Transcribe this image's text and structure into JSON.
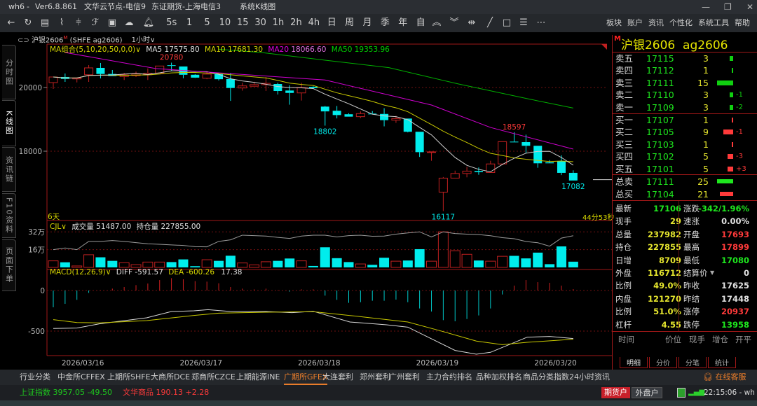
{
  "titlebar": {
    "app": "wh6",
    "sep": "-",
    "version": "Ver6.8.861",
    "node": "文华云节点-电信9",
    "broker": "东证期货-上海电信3",
    "window": "系统K线图"
  },
  "toolbar": {
    "periods": [
      "5s",
      "1",
      "5",
      "10",
      "15",
      "30",
      "1h",
      "2h",
      "4h",
      "日",
      "周",
      "月",
      "季",
      "年",
      "自"
    ],
    "menu": [
      "板块",
      "账户",
      "资讯",
      "个性化",
      "系统工具",
      "帮助"
    ]
  },
  "subheader": {
    "contract": "沪银2606",
    "marker": "M",
    "code": "(SHFE ag2606)",
    "period": "1小时"
  },
  "side_tabs": [
    "分时图",
    "K线图",
    "资讯链",
    "F10资料",
    "页面下单"
  ],
  "legend": {
    "ma_label": "MA组合(5,10,20,50,0,0)",
    "ma5": "MA5 17575.80",
    "ma10": "MA10 17681.30",
    "ma20": "MA20",
    "ma20_val": "18066.60",
    "ma50": "MA50 19353.96",
    "cjl": "CJL",
    "vol": "成交量 51487.00",
    "oi": "持仓量 227855.00",
    "macd": "MACD(12,26,9)",
    "diff": "DIFF -591.57",
    "dea": "DEA -600.26",
    "macd_val": "17.38",
    "days": "6天",
    "countdown": "44分53秒"
  },
  "chart_data": {
    "type": "candlestick",
    "price_ticks": [
      20000,
      18000
    ],
    "volume_ticks": [
      "32万",
      "16万"
    ],
    "volume_tick_values": [
      320000,
      160000
    ],
    "macd_ticks": [
      "0",
      "-500"
    ],
    "macd_tick_values": [
      0,
      -500
    ],
    "x_date_labels": [
      "2026/03/16",
      "2026/03/17",
      "2026/03/18",
      "2026/03/19",
      "2026/03/20"
    ],
    "x_date_positions": [
      2.5,
      12.5,
      22.5,
      32.5,
      42.5
    ],
    "annotations": [
      {
        "text": "20780",
        "index": 10,
        "color": "#ff3a3a",
        "pos": "above"
      },
      {
        "text": "18802",
        "index": 23,
        "color": "#00e8e8",
        "pos": "below"
      },
      {
        "text": "18597",
        "index": 39,
        "color": "#ff3a3a",
        "pos": "above"
      },
      {
        "text": "16117",
        "index": 33,
        "color": "#00e8e8",
        "pos": "below"
      },
      {
        "text": "17082",
        "index": 44,
        "color": "#00e8e8",
        "pos": "below"
      }
    ],
    "ohlc": [
      [
        20154,
        20330,
        19956,
        20330
      ],
      [
        20330,
        20440,
        20176,
        20270
      ],
      [
        20270,
        20310,
        20160,
        20300
      ],
      [
        20400,
        20704,
        20176,
        20616
      ],
      [
        20616,
        20770,
        20286,
        20425
      ],
      [
        20425,
        20550,
        20360,
        20360
      ],
      [
        20345,
        20460,
        20236,
        20396
      ],
      [
        20374,
        20500,
        20330,
        20425
      ],
      [
        20400,
        20600,
        20236,
        20447
      ],
      [
        20455,
        20675,
        20455,
        20675
      ],
      [
        20700,
        20780,
        20530,
        20680
      ],
      [
        20660,
        20660,
        20290,
        20400
      ],
      [
        20400,
        20420,
        20300,
        20310
      ],
      [
        20290,
        20500,
        20260,
        20420
      ],
      [
        20420,
        20420,
        20220,
        20260
      ],
      [
        20264,
        20460,
        19580,
        19985
      ],
      [
        19985,
        20150,
        19900,
        20050
      ],
      [
        20040,
        20180,
        20040,
        20090
      ],
      [
        20090,
        20330,
        19890,
        20130
      ],
      [
        20110,
        20150,
        19780,
        19890
      ],
      [
        19905,
        20070,
        19460,
        19830
      ],
      [
        19830,
        20150,
        19590,
        20000
      ],
      [
        20020,
        20040,
        19970,
        19980
      ],
      [
        19400,
        19420,
        18802,
        19250
      ],
      [
        19270,
        19420,
        19030,
        19135
      ],
      [
        19160,
        19190,
        19085,
        19085
      ],
      [
        19085,
        19250,
        19040,
        19180
      ],
      [
        19180,
        19260,
        19160,
        19160
      ],
      [
        19170,
        19350,
        18780,
        18975
      ],
      [
        18975,
        19110,
        18890,
        19025
      ],
      [
        19025,
        19025,
        18590,
        18610
      ],
      [
        18610,
        18610,
        17820,
        17970
      ],
      [
        17970,
        17990,
        17700,
        17980
      ],
      [
        16715,
        17190,
        16117,
        17155
      ],
      [
        17155,
        17390,
        17155,
        17300
      ],
      [
        17300,
        17510,
        17180,
        17375
      ],
      [
        17375,
        17490,
        17260,
        17340
      ],
      [
        17330,
        17700,
        17330,
        17600
      ],
      [
        17600,
        18300,
        17560,
        18300
      ],
      [
        18300,
        18597,
        18280,
        18280
      ],
      [
        18285,
        18520,
        17950,
        18170
      ],
      [
        18170,
        18170,
        17480,
        17620
      ],
      [
        17650,
        17720,
        17620,
        17620
      ],
      [
        17690,
        17870,
        17250,
        17320
      ],
      [
        17320,
        17400,
        17082,
        17080
      ]
    ],
    "volume": [
      59000,
      46000,
      13000,
      114000,
      91000,
      59000,
      42000,
      25000,
      48000,
      48000,
      48000,
      72000,
      11000,
      69000,
      59000,
      105000,
      40000,
      23000,
      51000,
      59000,
      80000,
      59000,
      13000,
      181000,
      83000,
      48000,
      31000,
      23000,
      87000,
      56000,
      62000,
      164000,
      56000,
      320000,
      150000,
      118000,
      62000,
      56000,
      100000,
      104000,
      81000,
      133000,
      29000,
      189000,
      51487
    ],
    "open_interest": [
      160000,
      175000,
      160000,
      234000,
      234000,
      242000,
      234000,
      223000,
      213000,
      208000,
      202000,
      198000,
      187000,
      185000,
      234000,
      248000,
      290000,
      286000,
      282000,
      270000,
      261000,
      282000,
      290000,
      290000,
      274000,
      286000,
      290000,
      280000,
      282000,
      299000,
      310000,
      320000,
      274000,
      320000,
      305000,
      299000,
      295000,
      285000,
      268000,
      258000,
      233000,
      222000,
      191000,
      264000,
      285000
    ],
    "ma20_points": [
      [
        1,
        21100
      ],
      [
        8.7,
        20594
      ],
      [
        23,
        20235
      ],
      [
        32,
        19450
      ],
      [
        37,
        18746
      ],
      [
        44,
        18066.6
      ]
    ],
    "ma50_points": [
      [
        14,
        21200
      ],
      [
        17.6,
        21100
      ],
      [
        23,
        20858
      ],
      [
        28.4,
        20623
      ],
      [
        34.3,
        20110
      ],
      [
        40.3,
        19635
      ],
      [
        44,
        19353.96
      ]
    ],
    "macd_hist": [
      -207,
      -164,
      -115,
      -29,
      3,
      23,
      43,
      66,
      86,
      129,
      152,
      138,
      115,
      109,
      89,
      43,
      23,
      14,
      23,
      5,
      -14,
      14,
      14,
      -63,
      -115,
      -152,
      -144,
      -126,
      -126,
      -112,
      -144,
      -221,
      -259,
      -365,
      -379,
      -351,
      -307,
      -221,
      -49,
      60,
      129,
      103,
      95,
      60,
      17.38
    ],
    "diff_points": [
      [
        0,
        -468
      ],
      [
        2,
        -462
      ],
      [
        3.9,
        -411
      ],
      [
        7.9,
        -336
      ],
      [
        10,
        -259
      ],
      [
        11.9,
        -250
      ],
      [
        13.1,
        -236
      ],
      [
        15,
        -259
      ],
      [
        18,
        -259
      ],
      [
        20.2,
        -273
      ],
      [
        22,
        -256
      ],
      [
        25.1,
        -388
      ],
      [
        28.2,
        -422
      ],
      [
        30,
        -451
      ],
      [
        31.8,
        -580
      ],
      [
        34,
        -738
      ],
      [
        35.8,
        -784
      ],
      [
        37,
        -761
      ],
      [
        40.1,
        -575
      ],
      [
        42,
        -566
      ],
      [
        44,
        -591.57
      ]
    ],
    "dea_points": [
      [
        0,
        -359
      ],
      [
        2,
        -394
      ],
      [
        3.9,
        -399
      ],
      [
        7.9,
        -371
      ],
      [
        11.9,
        -307
      ],
      [
        14,
        -279
      ],
      [
        18,
        -267
      ],
      [
        22,
        -261
      ],
      [
        26,
        -322
      ],
      [
        30,
        -388
      ],
      [
        32.7,
        -494
      ],
      [
        35.8,
        -623
      ],
      [
        38,
        -667
      ],
      [
        40.1,
        -638
      ],
      [
        44,
        -600.26
      ]
    ],
    "colors": {
      "up": "#c02020",
      "down": "#00eded",
      "ma5": "#d0d0d0",
      "ma10": "#c8c800",
      "ma20": "#d000d0",
      "ma50": "#00b000"
    }
  },
  "quote": {
    "marker": "M",
    "title": "沪银2606  ag2606",
    "asks": [
      {
        "label": "卖五",
        "price": "17115",
        "qty": 3,
        "chg": ""
      },
      {
        "label": "卖四",
        "price": "17112",
        "qty": 1,
        "chg": ""
      },
      {
        "label": "卖三",
        "price": "17111",
        "qty": 15,
        "chg": ""
      },
      {
        "label": "卖二",
        "price": "17110",
        "qty": 3,
        "chg": "-1"
      },
      {
        "label": "卖一",
        "price": "17109",
        "qty": 3,
        "chg": "-2"
      }
    ],
    "bids": [
      {
        "label": "买一",
        "price": "17107",
        "qty": 1,
        "chg": ""
      },
      {
        "label": "买二",
        "price": "17105",
        "qty": 9,
        "chg": "-1"
      },
      {
        "label": "买三",
        "price": "17103",
        "qty": 1,
        "chg": ""
      },
      {
        "label": "买四",
        "price": "17102",
        "qty": 5,
        "chg": "-3"
      },
      {
        "label": "买五",
        "price": "17101",
        "qty": 5,
        "chg": "+3"
      }
    ],
    "totals": [
      {
        "label": "总卖",
        "price": "17111",
        "qty": 25,
        "color": "#1ee61e"
      },
      {
        "label": "总买",
        "price": "17104",
        "qty": 21,
        "color": "#ff3a3a"
      }
    ],
    "stats_left": [
      {
        "label": "最新",
        "value": "17106",
        "color": "#1ee61e"
      },
      {
        "label": "现手",
        "value": "29",
        "color": "#e6e62e"
      },
      {
        "label": "总量",
        "value": "237982",
        "color": "#e6e62e"
      },
      {
        "label": "持仓",
        "value": "227855",
        "color": "#e6e62e"
      },
      {
        "label": "日增",
        "value": "8709",
        "color": "#e6e62e"
      },
      {
        "label": "外盘",
        "value": "116712",
        "color": "#e6e62e"
      },
      {
        "label": "比例",
        "value": "49.0%",
        "color": "#e6e62e"
      },
      {
        "label": "内盘",
        "value": "121270",
        "color": "#e6e62e"
      },
      {
        "label": "比例",
        "value": "51.0%",
        "color": "#e6e62e"
      },
      {
        "label": "杠杆",
        "value": "4.55",
        "color": "#e6e62e"
      }
    ],
    "stats_right": [
      {
        "label": "涨跌",
        "value": "-342/1.96%",
        "color": "#1ee61e"
      },
      {
        "label": "速涨",
        "value": "0.00%",
        "color": "#e0e0e0"
      },
      {
        "label": "开盘",
        "value": "17693",
        "color": "#ff3a3a"
      },
      {
        "label": "最高",
        "value": "17899",
        "color": "#ff3a3a"
      },
      {
        "label": "最低",
        "value": "17080",
        "color": "#1ee61e"
      },
      {
        "label": "结算价",
        "value": "0",
        "color": "#e0e0e0"
      },
      {
        "label": "昨收",
        "value": "17625",
        "color": "#e0e0e0"
      },
      {
        "label": "昨结",
        "value": "17448",
        "color": "#e0e0e0"
      },
      {
        "label": "涨停",
        "value": "20937",
        "color": "#ff3a3a"
      },
      {
        "label": "跌停",
        "value": "13958",
        "color": "#1ee61e"
      }
    ],
    "detail_headers": [
      "时间",
      "价位",
      "现手",
      "增仓",
      "开平"
    ],
    "tabs": [
      "明细",
      "分价",
      "分笔",
      "统计"
    ]
  },
  "bottom_tabs": [
    "行业分类",
    "中金所CFFEX",
    "上期所SHFE",
    "大商所DCE",
    "郑商所CZCE",
    "上期能源INE",
    "广期所GFEX",
    "大连套利",
    "郑州套利",
    "广州套利",
    "主力合约排名",
    "品种加权排名",
    "商品分类指数",
    "24小时资讯"
  ],
  "bottom_active": 6,
  "service": "在线客服",
  "status": {
    "idx1_name": "上证指数",
    "idx1_val": "3957.05",
    "idx1_chg": "-49.50",
    "idx2_name": "文华商品",
    "idx2_val": "190.13",
    "idx2_chg": "+2.28",
    "btn_futures": "期货户",
    "btn_foreign": "外盘户",
    "time": "22:15:06 - wh"
  }
}
